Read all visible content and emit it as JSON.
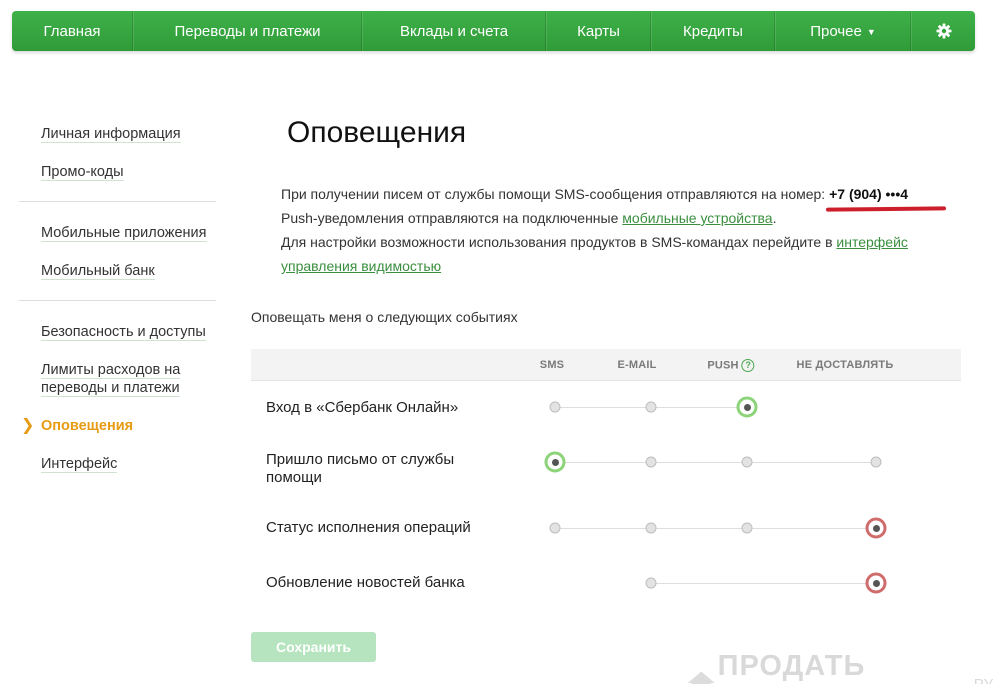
{
  "nav": {
    "items": [
      {
        "label": "Главная"
      },
      {
        "label": "Переводы и платежи"
      },
      {
        "label": "Вклады и счета"
      },
      {
        "label": "Карты"
      },
      {
        "label": "Кредиты"
      },
      {
        "label": "Прочее",
        "dropdown": true
      }
    ],
    "settings_icon": "gear-icon"
  },
  "sidebar": {
    "groups": [
      [
        "Личная информация",
        "Промо-коды"
      ],
      [
        "Мобильные приложения",
        "Мобильный банк"
      ],
      [
        "Безопасность и доступы",
        "Лимиты расходов на переводы и платежи",
        "Оповещения",
        "Интерфейс"
      ]
    ],
    "active": "Оповещения"
  },
  "page": {
    "title": "Оповещения",
    "line1_text": "При получении писем от службы помощи SMS-сообщения отправляются на номер: ",
    "phone": "+7 (904) •••4",
    "line2_text": "Push-уведомления отправляются на подключенные ",
    "line2_link": "мобильные устройства",
    "line2_end": ".",
    "line3_text": "Для настройки возможности использования продуктов в SMS-командах перейдите в ",
    "line3_link_a": "интерфейс",
    "line3_link_b": "управления видимостью"
  },
  "notifications": {
    "section_label": "Оповещать меня о следующих событиях",
    "columns": [
      "SMS",
      "E-MAIL",
      "PUSH",
      "НЕ ДОСТАВЛЯТЬ"
    ],
    "rows": [
      {
        "label": "Вход в «Сбербанк Онлайн»",
        "options": [
          "sms",
          "email",
          "push"
        ],
        "selected": "push"
      },
      {
        "label": "Пришло письмо от службы помощи",
        "options": [
          "sms",
          "email",
          "push",
          "none"
        ],
        "selected": "sms"
      },
      {
        "label": "Статус исполнения операций",
        "options": [
          "sms",
          "email",
          "push",
          "none"
        ],
        "selected": "none"
      },
      {
        "label": "Обновление новостей банка",
        "options": [
          "email",
          "none"
        ],
        "selected": "none"
      }
    ]
  },
  "save_label": "Сохранить",
  "watermark": {
    "text": "ПРОДАТЬ ДОЛГИ",
    "suffix": "РУ"
  },
  "colors": {
    "nav_green": "#34a33d",
    "link_green": "#3a8f3e",
    "active_orange": "#e69b12",
    "select_green": "#8dd37a",
    "select_red": "#cf6c6c",
    "underline_red": "#cc1f2b"
  }
}
